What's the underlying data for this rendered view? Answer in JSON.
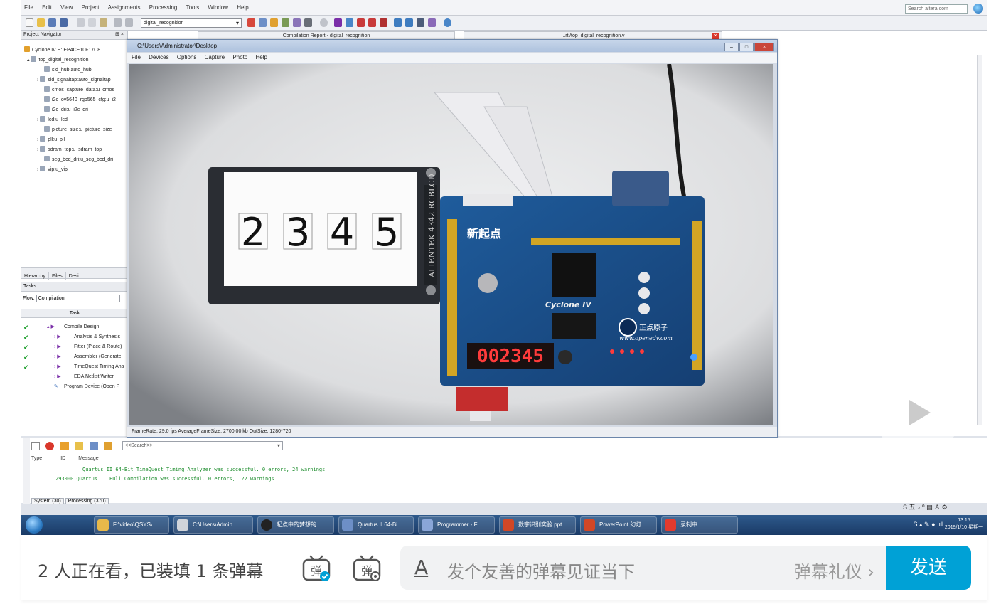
{
  "quartus": {
    "menu": [
      "File",
      "Edit",
      "View",
      "Project",
      "Assignments",
      "Processing",
      "Tools",
      "Window",
      "Help"
    ],
    "search_placeholder": "Search altera.com",
    "project_select": "digital_recognition",
    "project_navigator_title": "Project Navigator",
    "device": "Cyclone IV E: EP4CE10F17C8",
    "top_entity": "top_digital_recognition",
    "hierarchy": [
      "sld_hub:auto_hub",
      "sld_signaltap:auto_signaltap",
      "cmos_capture_data:u_cmos_",
      "i2c_ov5640_rgb565_cfg:u_i2",
      "i2c_dri:u_i2c_dri",
      "lcd:u_lcd",
      "picture_size:u_picture_size",
      "pll:u_pll",
      "sdram_top:u_sdram_top",
      "seg_bcd_dri:u_seg_bcd_dri",
      "vip:u_vip"
    ],
    "nav_tabs": [
      "Hierarchy",
      "Files",
      "Desi"
    ],
    "tasks_title": "Tasks",
    "flow_label": "Flow:",
    "flow_value": "Compilation",
    "task_column": "Task",
    "tasks": [
      "Compile Design",
      "Analysis & Synthesis",
      "Fitter (Place & Route)",
      "Assembler (Generate",
      "TimeQuest Timing Ana",
      "EDA Netlist Writer",
      "Program Device (Open P"
    ],
    "report_tab": "Compilation Report - digital_recognition",
    "file_tab": "...rtl/top_digital_recognition.v",
    "messages": {
      "search_placeholder": "<<Search>>",
      "columns": [
        "Type",
        "ID",
        "Message"
      ],
      "lines": [
        "Quartus II 64-Bit TimeQuest Timing Analyzer was successful. 0 errors, 24 warnings",
        "293000 Quartus II Full Compilation was successful. 0 errors, 122 warnings"
      ],
      "tabs": [
        "System (30)",
        "Processing (370)"
      ]
    }
  },
  "camera_window": {
    "title": "C:\\Users\\Administrator\\Desktop",
    "menu": [
      "File",
      "Devices",
      "Options",
      "Capture",
      "Photo",
      "Help"
    ],
    "status": "FrameRate: 29.0 fps    AverageFrameSize: 2700.00 kb    OutSize: 1280*720",
    "lcd_digits": [
      "2",
      "3",
      "4",
      "5"
    ],
    "seg_display": "002345",
    "lcd_brand": "ALIENTEK 4342 RGBLCD",
    "board_brand": "新起点",
    "board_chip": "Cyclone IV",
    "board_logo": "正点原子",
    "board_url": "www.openedv.com"
  },
  "taskbar": {
    "items": [
      "F:\\video\\QSYS\\...",
      "C:\\Users\\Admin...",
      "起点中的梦想的 ...",
      "Quartus II 64-Bi...",
      "Programmer - F...",
      "数字识别实验.ppt...",
      "PowerPoint 幻灯...",
      "录制中..."
    ],
    "clock_time": "13:15",
    "clock_date": "2019/1/10 星期一"
  },
  "danmaku": {
    "viewer_text": "2 人正在看，已装填 1 条弹幕",
    "input_placeholder": "发个友善的弹幕见证当下",
    "input_icon": "A",
    "etiquette": "弹幕礼仪 ›",
    "send": "发送",
    "accent": "#00a1d6"
  }
}
